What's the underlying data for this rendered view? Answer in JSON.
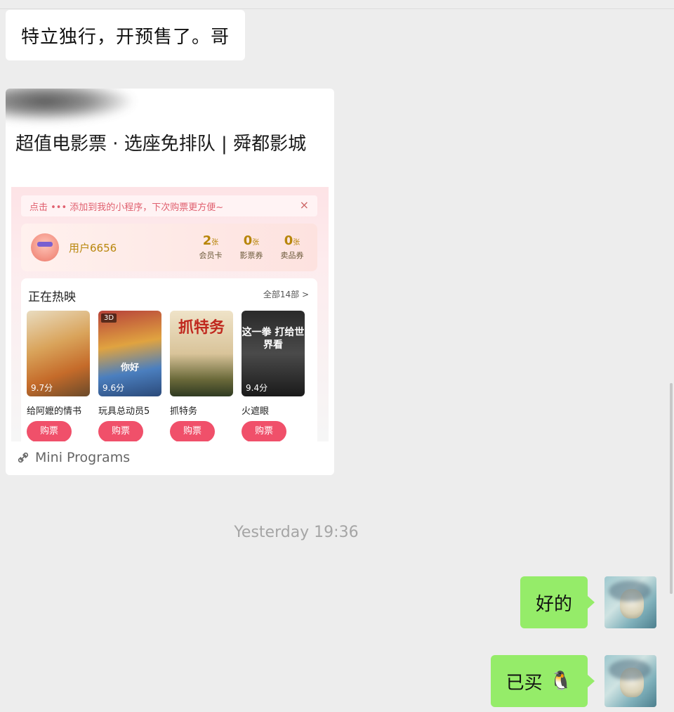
{
  "messages": {
    "incoming_text": "特立独行，开预售了。哥",
    "mini_program": {
      "title": "超值电影票 · 选座免排队 | 舜都影城",
      "tip": "点击 ••• 添加到我的小程序，下次购票更方便~",
      "tip_close": "×",
      "user_name": "用户6656",
      "stats": [
        {
          "num": "2",
          "unit": "张",
          "label": "会员卡"
        },
        {
          "num": "0",
          "unit": "张",
          "label": "影票券"
        },
        {
          "num": "0",
          "unit": "张",
          "label": "卖品券"
        }
      ],
      "section_title": "正在热映",
      "section_all": "全部14部 >",
      "buy_label": "购票",
      "movies": [
        {
          "name": "给阿嬷的情书",
          "score": "9.7分",
          "poster_text": "",
          "badge": ""
        },
        {
          "name": "玩具总动员5",
          "score": "9.6分",
          "poster_text": "你好",
          "badge": "3D"
        },
        {
          "name": "抓特务",
          "score": "",
          "poster_text": "抓特务",
          "badge": ""
        },
        {
          "name": "火遮眼",
          "score": "9.4分",
          "poster_text": "这一拳 打给世界看",
          "badge": ""
        }
      ],
      "footer": "Mini Programs"
    },
    "timestamp": "Yesterday 19:36",
    "outgoing": [
      {
        "text": "好的",
        "emoji": ""
      },
      {
        "text": "已买",
        "emoji": "🐧"
      }
    ]
  }
}
